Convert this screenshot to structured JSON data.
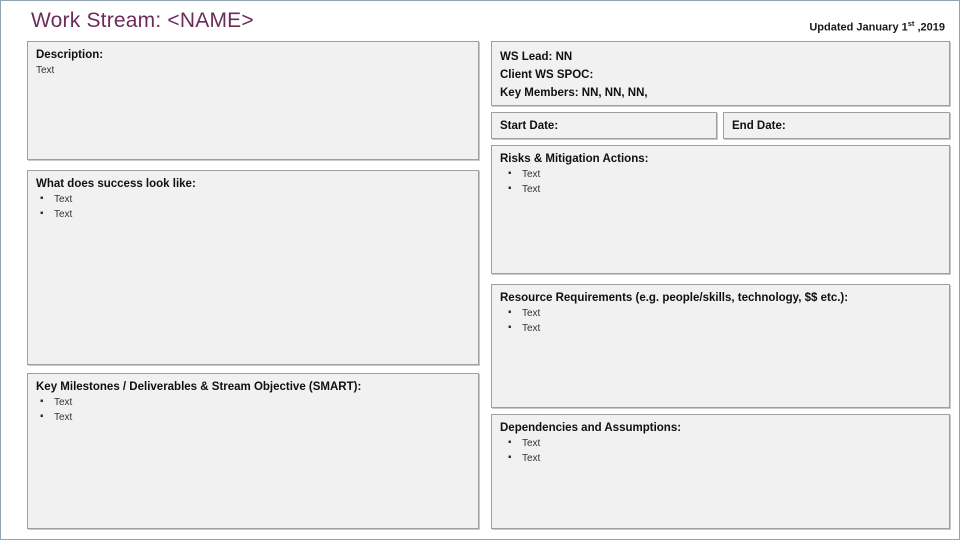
{
  "header": {
    "title": "Work Stream: <NAME>",
    "updated_prefix": "Updated January 1",
    "updated_sup": "st",
    "updated_suffix": " ,2019",
    "title_color": "#6b2c5c"
  },
  "panels": {
    "description": {
      "heading": "Description:",
      "body": "Text"
    },
    "success": {
      "heading": "What does success look like:",
      "bullets": [
        "Text",
        "Text"
      ]
    },
    "milestones": {
      "heading": "Key Milestones / Deliverables & Stream Objective (SMART):",
      "bullets": [
        "Text",
        "Text"
      ]
    },
    "team": {
      "ws_lead": "WS Lead: NN",
      "client_spoc": "Client WS SPOC:",
      "key_members": "Key Members: NN, NN, NN,"
    },
    "start_date": {
      "label": "Start Date:",
      "value": ""
    },
    "end_date": {
      "label": "End Date:",
      "value": ""
    },
    "risks": {
      "heading": "Risks & Mitigation Actions:",
      "bullets": [
        "Text",
        "Text"
      ]
    },
    "resources": {
      "heading": "Resource Requirements (e.g. people/skills, technology, $$ etc.):",
      "bullets": [
        "Text",
        "Text"
      ]
    },
    "dependencies": {
      "heading": "Dependencies and Assumptions:",
      "bullets": [
        "Text",
        "Text"
      ]
    }
  },
  "colors": {
    "panel_background": "#f1f1f1",
    "panel_border": "#9f9f9f",
    "slide_border": "#8fa3b0",
    "text": "#333333",
    "heading": "#101010"
  }
}
